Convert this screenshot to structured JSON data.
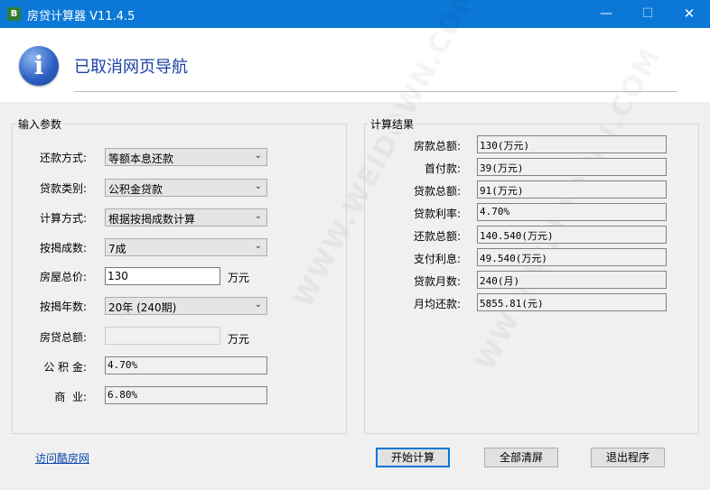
{
  "window": {
    "title": "房贷计算器 V11.4.5",
    "icon": "calculator-app-icon",
    "minimize": "—",
    "maximize": "☐",
    "close": "✕"
  },
  "banner": {
    "title": "已取消网页导航",
    "icon": "info-icon",
    "icon_glyph": "i"
  },
  "input_group": {
    "label": "输入参数",
    "repay_method": {
      "label": "还款方式:",
      "value": "等额本息还款"
    },
    "loan_type": {
      "label": "贷款类别:",
      "value": "公积金贷款"
    },
    "calc_method": {
      "label": "计算方式:",
      "value": "根据按揭成数计算"
    },
    "mortgage_ratio": {
      "label": "按揭成数:",
      "value": "7成"
    },
    "house_price": {
      "label": "房屋总价:",
      "value": "130",
      "unit": "万元"
    },
    "mortgage_years": {
      "label": "按揭年数:",
      "value": "20年 (240期)"
    },
    "loan_total": {
      "label": "房贷总额:",
      "value": "",
      "unit": "万元"
    },
    "provident_rate": {
      "label": "公 积 金:",
      "value": "4.70%"
    },
    "commercial_rate": {
      "label": "商  业:",
      "value": "6.80%"
    }
  },
  "result_group": {
    "label": "计算结果",
    "rows": [
      {
        "label": "房款总额:",
        "value": "130(万元)"
      },
      {
        "label": "首付款:",
        "value": "39(万元)"
      },
      {
        "label": "贷款总额:",
        "value": "91(万元)"
      },
      {
        "label": "贷款利率:",
        "value": "4.70%"
      },
      {
        "label": "还款总额:",
        "value": "140.540(万元)"
      },
      {
        "label": "支付利息:",
        "value": "49.540(万元)"
      },
      {
        "label": "贷款月数:",
        "value": "240(月)"
      },
      {
        "label": "月均还款:",
        "value": "5855.81(元)"
      }
    ]
  },
  "footer": {
    "link": "访问酷房网",
    "start_button": "开始计算",
    "clear_button": "全部清屏",
    "exit_button": "退出程序"
  },
  "watermark": "WWW.WEIDOWN.COM"
}
